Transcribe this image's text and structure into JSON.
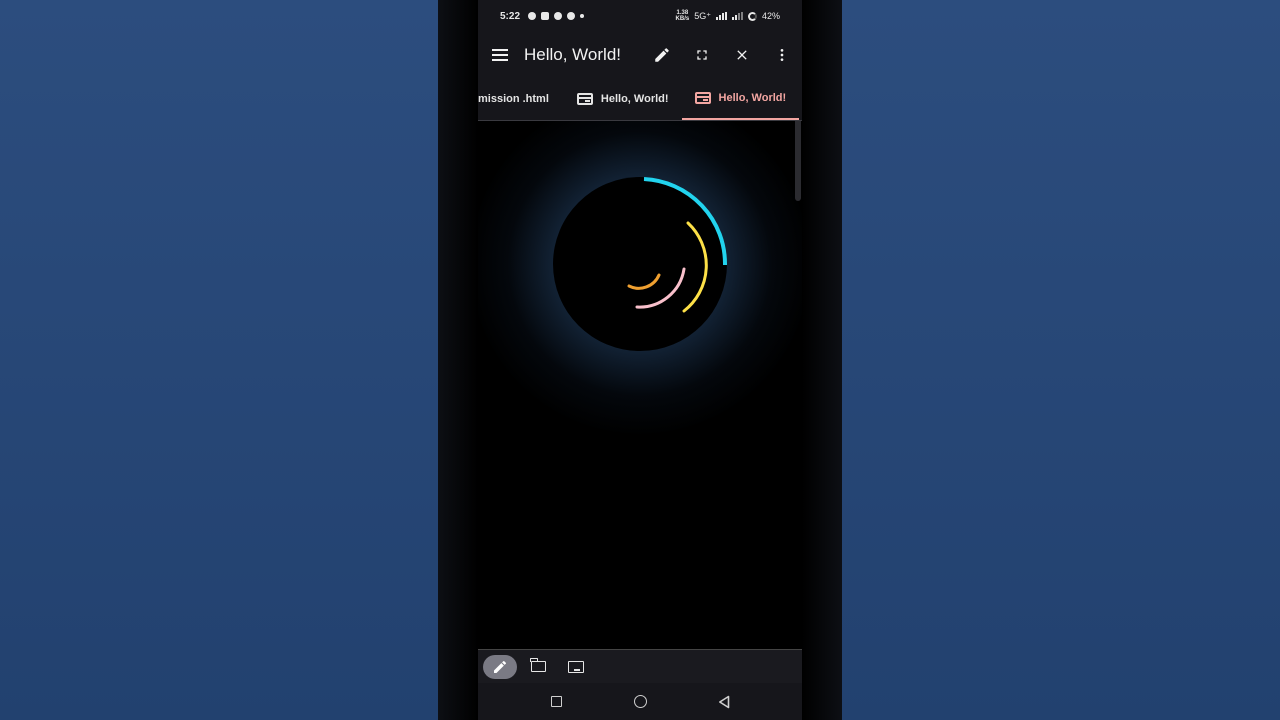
{
  "status_bar": {
    "time": "5:22",
    "net_speed_value": "1.38",
    "net_speed_unit": "KB/s",
    "network": "5G⁺",
    "battery": "42%"
  },
  "app_bar": {
    "title": "Hello, World!",
    "menu_icon": "menu-icon",
    "edit_icon": "edit-icon",
    "fullscreen_icon": "fullscreen-icon",
    "close_icon": "close-icon",
    "more_icon": "more-vert-icon"
  },
  "tabs": [
    {
      "label": "mission .html",
      "active": false
    },
    {
      "label": "Hello, World!",
      "active": false
    },
    {
      "label": "Hello, World!",
      "active": true
    }
  ],
  "bottom_toolbar": {
    "buttons": [
      "edit-icon",
      "folder-icon",
      "terminal-icon"
    ],
    "active_index": 0
  },
  "nav_bar": {
    "buttons": [
      "recents-square",
      "home-circle",
      "back-triangle"
    ]
  },
  "colors": {
    "accent_tab": "#f3a6a2",
    "arc_outer": "#22d3ee",
    "arc_second": "#fde047",
    "arc_third": "#f9c0cb",
    "arc_inner": "#f0a030",
    "glow": "#78b4f0",
    "background_outer": "#2b4b7c"
  }
}
